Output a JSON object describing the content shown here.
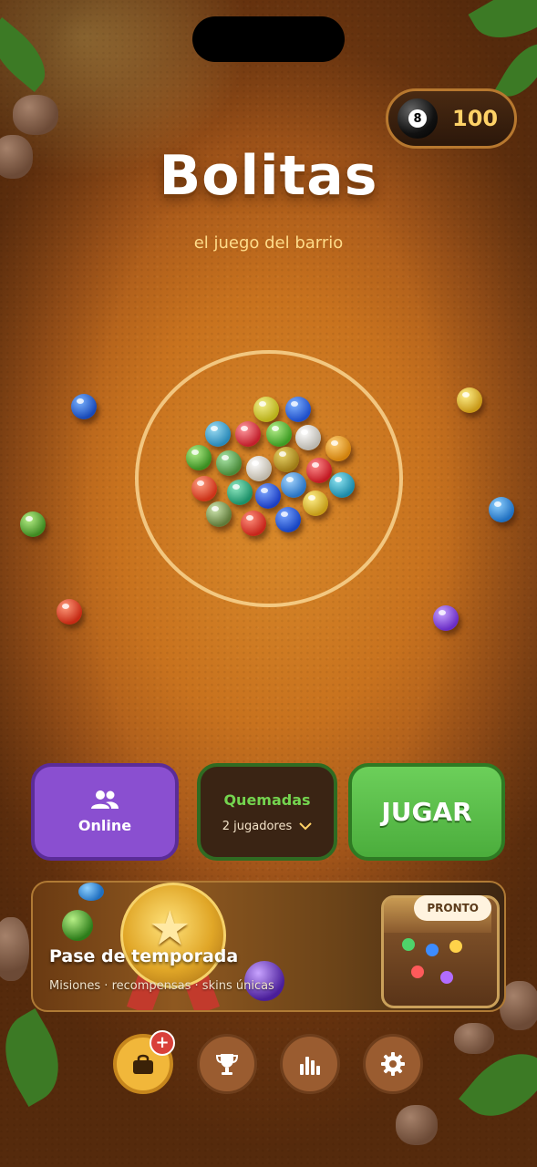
{
  "header": {
    "coins": {
      "value": "100",
      "icon": "eight-ball-icon",
      "ball_number": "8"
    },
    "title": "Bolitas",
    "subtitle": "el juego del barrio"
  },
  "actions": {
    "online": {
      "label": "Online",
      "icon": "people-icon"
    },
    "mode": {
      "name": "Quemadas",
      "players": "2 jugadores",
      "icon": "chevron-down-icon"
    },
    "play": {
      "label": "JUGAR"
    }
  },
  "season_pass": {
    "title": "Pase de temporada",
    "subtitle": "Misiones · recompensas · skins únicas",
    "status": "PRONTO"
  },
  "bottom_nav": {
    "items": [
      {
        "icon": "shop-bag-icon",
        "badge": "+"
      },
      {
        "icon": "trophy-icon"
      },
      {
        "icon": "stats-icon"
      },
      {
        "icon": "settings-icon"
      }
    ]
  },
  "colors": {
    "online": "#8a4fd0",
    "play": "#4bad3c",
    "mode_text": "#74d44f",
    "coin_text": "#ffd267",
    "subtitle": "#ffdc8a"
  }
}
